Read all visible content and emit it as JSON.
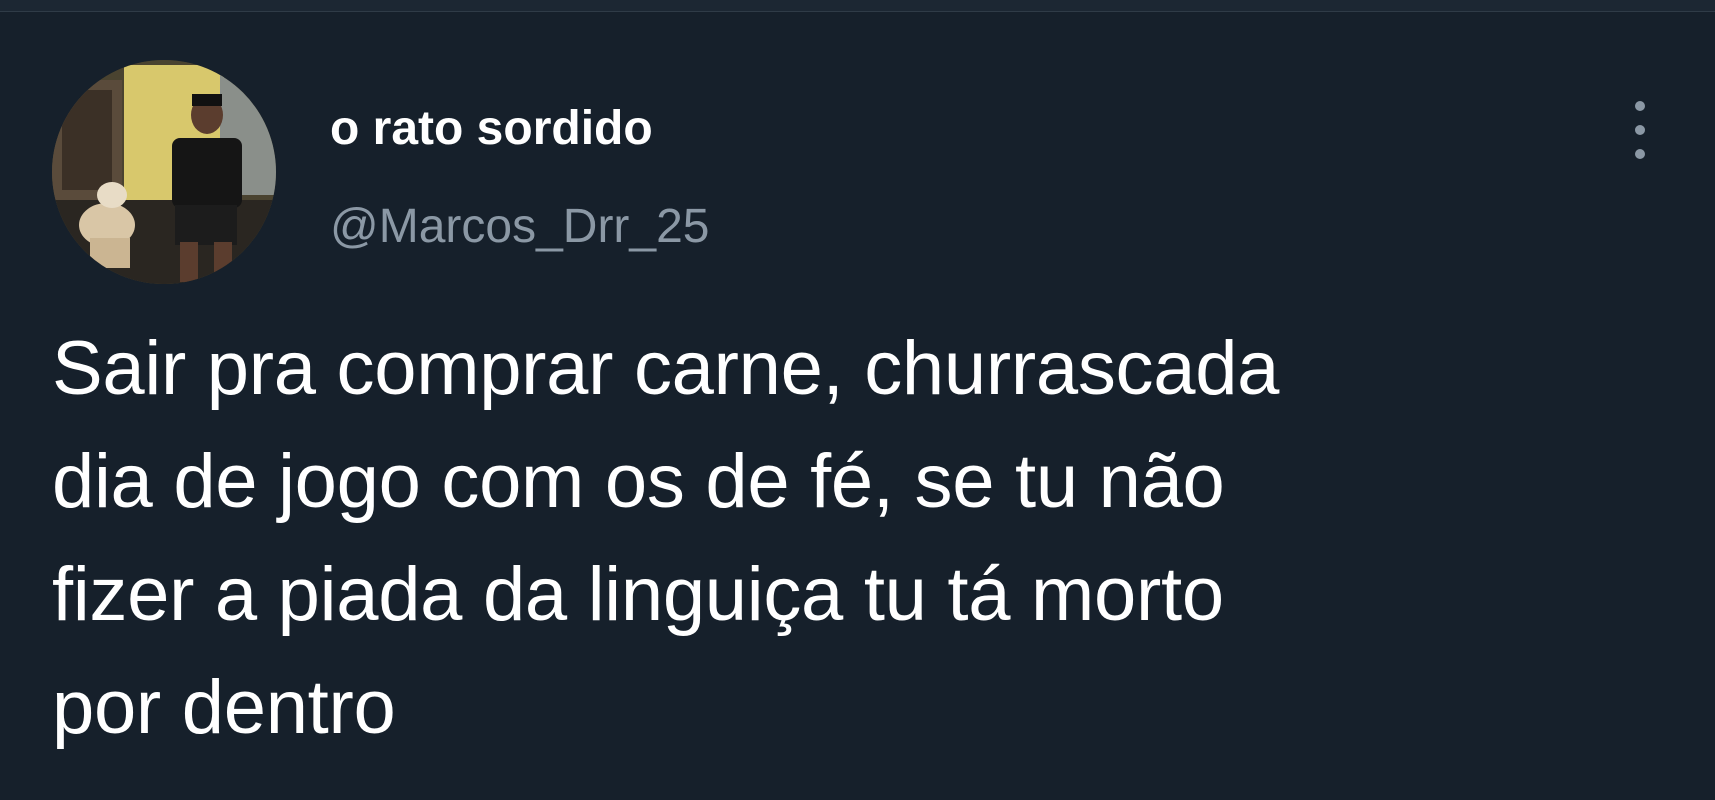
{
  "tweet": {
    "author": {
      "display_name": "o rato sordido",
      "handle": "@Marcos_Drr_25",
      "avatar_icon": "profile-photo-avatar"
    },
    "more_icon": "more-options-vertical-dots-icon",
    "text_lines": [
      "Sair pra comprar carne, churrascada",
      "dia de jogo com os de fé, se tu não",
      "fizer a piada da linguiça tu tá morto",
      "por dentro"
    ]
  },
  "colors": {
    "background": "#16202b",
    "text_primary": "#ffffff",
    "text_secondary": "#8b98a5"
  }
}
